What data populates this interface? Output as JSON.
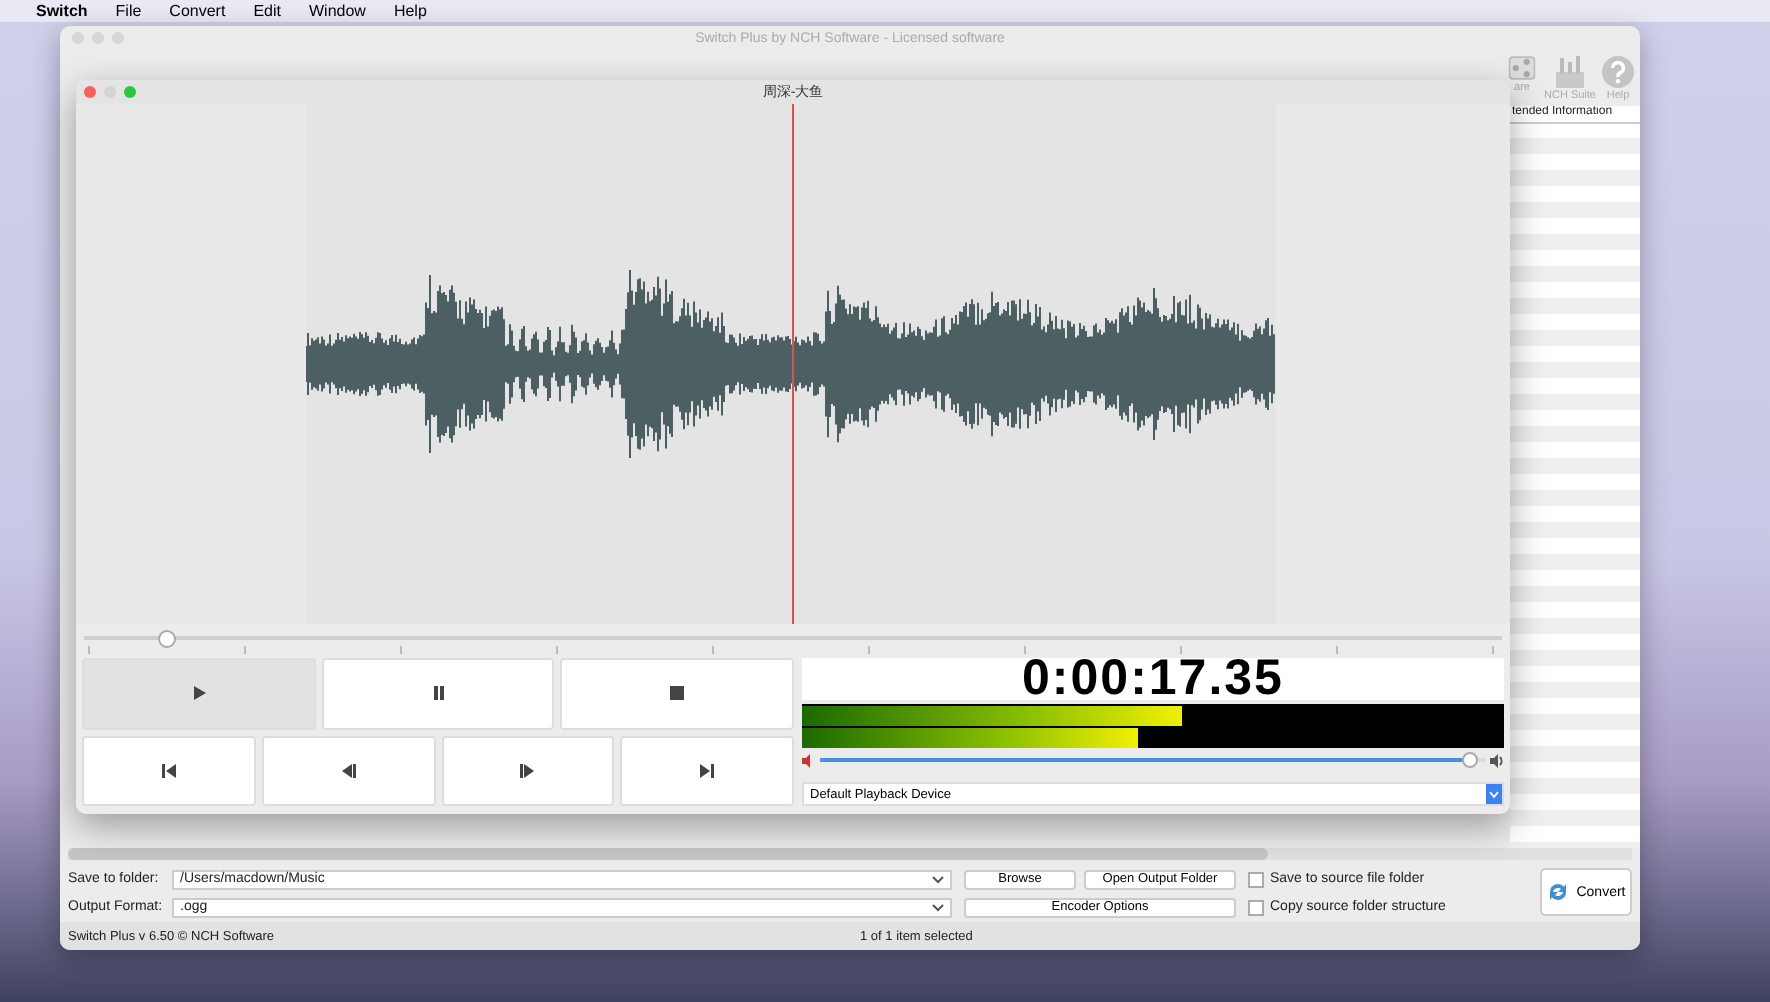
{
  "menu_bar": {
    "items": [
      "Switch",
      "File",
      "Convert",
      "Edit",
      "Window",
      "Help"
    ]
  },
  "main_window": {
    "title": "Switch Plus by NCH Software - Licensed software",
    "toolbar_right": [
      {
        "kind": "share",
        "label": "are"
      },
      {
        "kind": "suite",
        "label": "NCH Suite"
      },
      {
        "kind": "help",
        "label": "Help"
      }
    ],
    "list_header": "tended Information",
    "save_to_folder": {
      "label": "Save to folder:",
      "value": "/Users/macdown/Music"
    },
    "output_format": {
      "label": "Output Format:",
      "value": ".ogg"
    },
    "buttons": [
      "Browse",
      "Open Output Folder",
      "Encoder Options"
    ],
    "checkboxes": [
      {
        "label": "Save to source file folder",
        "checked": false
      },
      {
        "label": "Copy source folder structure",
        "checked": false
      }
    ],
    "convert_button": "Convert",
    "status_bar": {
      "version": "Switch Plus v 6.50 © NCH Software",
      "selection": "1 of 1 item selected"
    }
  },
  "player_window": {
    "title": "周深-大鱼",
    "position": {
      "level": 0.058
    },
    "transport": [
      {
        "kind": "play",
        "selected": true
      },
      {
        "kind": "pause",
        "selected": false
      },
      {
        "kind": "stop",
        "selected": false
      },
      {
        "kind": "start",
        "selected": false
      },
      {
        "kind": "back",
        "selected": false
      },
      {
        "kind": "forward",
        "selected": false
      },
      {
        "kind": "end",
        "selected": false
      }
    ],
    "time": "0:00:17.35",
    "meters": [
      {
        "level": 0.54
      },
      {
        "level": 0.48
      }
    ],
    "volume": {
      "level": 0.98
    },
    "device": "Default Playback Device"
  }
}
